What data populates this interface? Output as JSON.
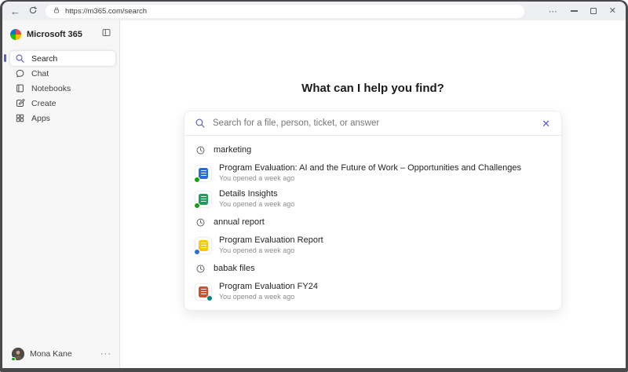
{
  "colors": {
    "accent": "#5b5fc7",
    "word_blue": "#2b6bd8",
    "excel_green": "#1e9e5a",
    "doc_yellow": "#fdc617",
    "powerpoint_red": "#d14f2a",
    "presence_green": "#13a10e",
    "titlebar_bg": "#edeff2",
    "sidebar_bg": "#f7f7f8"
  },
  "browser": {
    "url": "https://m365.com/search",
    "back_glyph": "←",
    "more_glyph": "⋯",
    "close_glyph": "✕"
  },
  "sidebar": {
    "brand": "Microsoft 365",
    "items": [
      {
        "label": "Search",
        "selected": true
      },
      {
        "label": "Chat",
        "selected": false
      },
      {
        "label": "Notebooks",
        "selected": false
      },
      {
        "label": "Create",
        "selected": false
      },
      {
        "label": "Apps",
        "selected": false
      }
    ],
    "user": {
      "name": "Mona Kane",
      "more_glyph": "···"
    }
  },
  "main": {
    "heading": "What can I help you find?",
    "search": {
      "placeholder": "Search for a file, person, ticket, or answer",
      "clear_glyph": "✕"
    },
    "suggestions": [
      {
        "type": "query",
        "text": "marketing"
      },
      {
        "type": "file",
        "app": "word",
        "title": "Program Evaluation: AI and the Future of Work – Opportunities and Challenges",
        "subtitle": "You opened a week ago"
      },
      {
        "type": "file",
        "app": "excel",
        "title": "Details Insights",
        "subtitle": "You opened a week ago"
      },
      {
        "type": "query",
        "text": "annual report"
      },
      {
        "type": "file",
        "app": "yellow-doc",
        "title": "Program Evaluation Report",
        "subtitle": "You opened a week ago"
      },
      {
        "type": "query",
        "text": "babak files"
      },
      {
        "type": "file",
        "app": "powerpoint",
        "title": "Program Evaluation FY24",
        "subtitle": "You opened a week ago"
      }
    ]
  }
}
